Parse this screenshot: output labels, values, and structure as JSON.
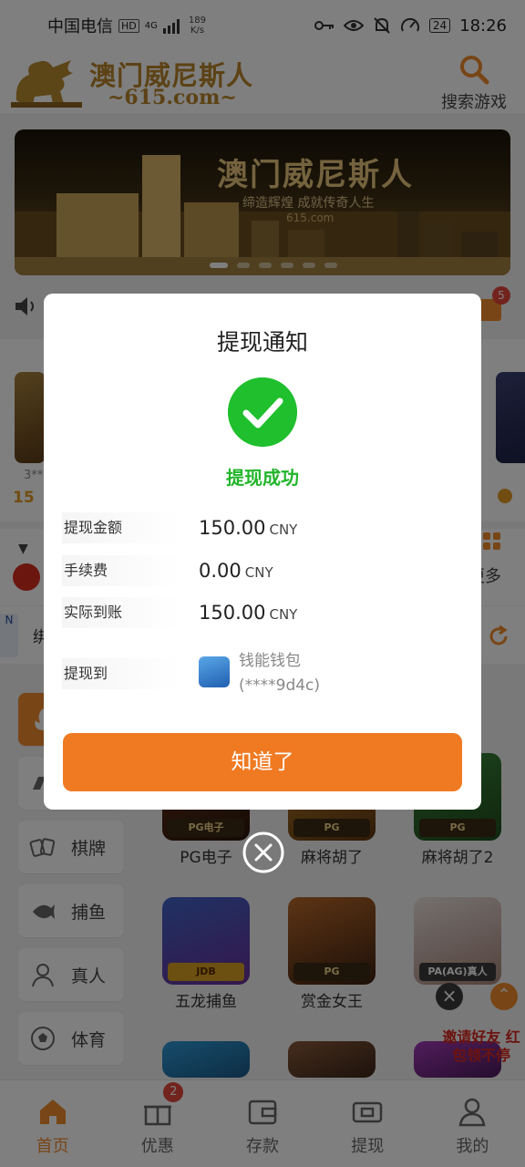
{
  "status_bar": {
    "carrier": "中国电信",
    "hd": "HD",
    "net": "4G",
    "speed_value": "189",
    "speed_unit": "K/s",
    "battery": "24",
    "time": "18:26"
  },
  "header": {
    "logo_title": "澳门威尼斯人",
    "logo_domain": "~615.com~",
    "search_label": "搜索游戏",
    "icons": {
      "logo": "winged-lion-logo",
      "search": "search-icon"
    }
  },
  "banner": {
    "title": "澳门威尼斯人",
    "slogan": "缔造辉煌 成就传奇人生",
    "domain": "615.com"
  },
  "notice": {
    "mail_badge": "5"
  },
  "strip": {
    "left_text": "3***",
    "left_coin": "15"
  },
  "user_row": {
    "more_label": "更多"
  },
  "ticker": {
    "side_label": "N",
    "text": "绑"
  },
  "categories": [
    {
      "label": "",
      "icon": "hot-icon",
      "active": true
    },
    {
      "label": "",
      "icon": "electronic-icon"
    },
    {
      "label": "棋牌",
      "icon": "cards-icon"
    },
    {
      "label": "捕鱼",
      "icon": "fish-icon"
    },
    {
      "label": "真人",
      "icon": "dealer-icon"
    },
    {
      "label": "体育",
      "icon": "soccer-icon"
    }
  ],
  "games": [
    {
      "name": "PG电子",
      "tag": "PG电子"
    },
    {
      "name": "麻将胡了",
      "tag": "PG"
    },
    {
      "name": "麻将胡了2",
      "tag": "PG"
    },
    {
      "name": "五龙捕鱼",
      "tag": "JDB"
    },
    {
      "name": "赏金女王",
      "tag": "PG"
    },
    {
      "name": "",
      "tag": "PA(AG)真人"
    }
  ],
  "invite": {
    "text": "邀请好友 红包领不停"
  },
  "bottom_nav": [
    {
      "label": "首页",
      "icon": "home-icon",
      "active": true
    },
    {
      "label": "优惠",
      "icon": "gift-icon",
      "badge": "2"
    },
    {
      "label": "存款",
      "icon": "wallet-icon"
    },
    {
      "label": "提现",
      "icon": "withdraw-icon"
    },
    {
      "label": "我的",
      "icon": "user-icon"
    }
  ],
  "dialog": {
    "title": "提现通知",
    "status_text": "提现成功",
    "rows": [
      {
        "label": "提现金额",
        "value": "150.00",
        "currency": "CNY"
      },
      {
        "label": "手续费",
        "value": "0.00",
        "currency": "CNY"
      },
      {
        "label": "实际到账",
        "value": "150.00",
        "currency": "CNY"
      }
    ],
    "dest_label": "提现到",
    "wallet_name": "钱能钱包",
    "wallet_account": "(****9d4c)",
    "ok_label": "知道了",
    "colors": {
      "success": "#1fbf2d",
      "button": "#f07a22"
    }
  }
}
